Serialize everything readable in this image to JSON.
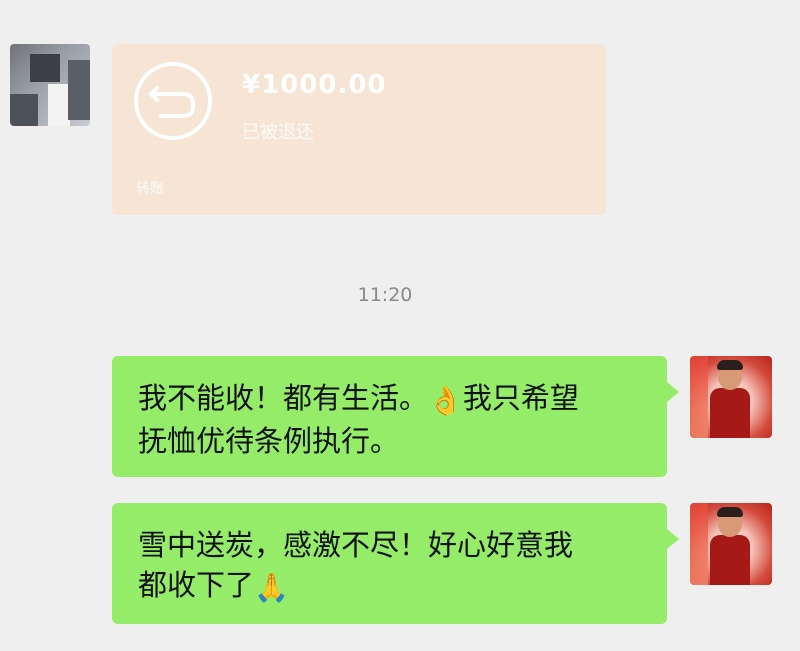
{
  "transfer": {
    "amount": "¥1000.00",
    "status": "已被退还",
    "footer": "转账"
  },
  "timestamp": "11:20",
  "messages": [
    {
      "line1": "我不能收！都有生活。",
      "emoji1": "👌",
      "line1b": "我只希望",
      "line2": "抚恤优待条例执行。"
    },
    {
      "line1": "雪中送炭，感激不尽！好心好意我",
      "line2": "都收下了",
      "emoji2": "🙏"
    }
  ],
  "colors": {
    "background": "#efefef",
    "bubble_green": "#95ec69",
    "transfer_card": "#f6e5d4"
  }
}
